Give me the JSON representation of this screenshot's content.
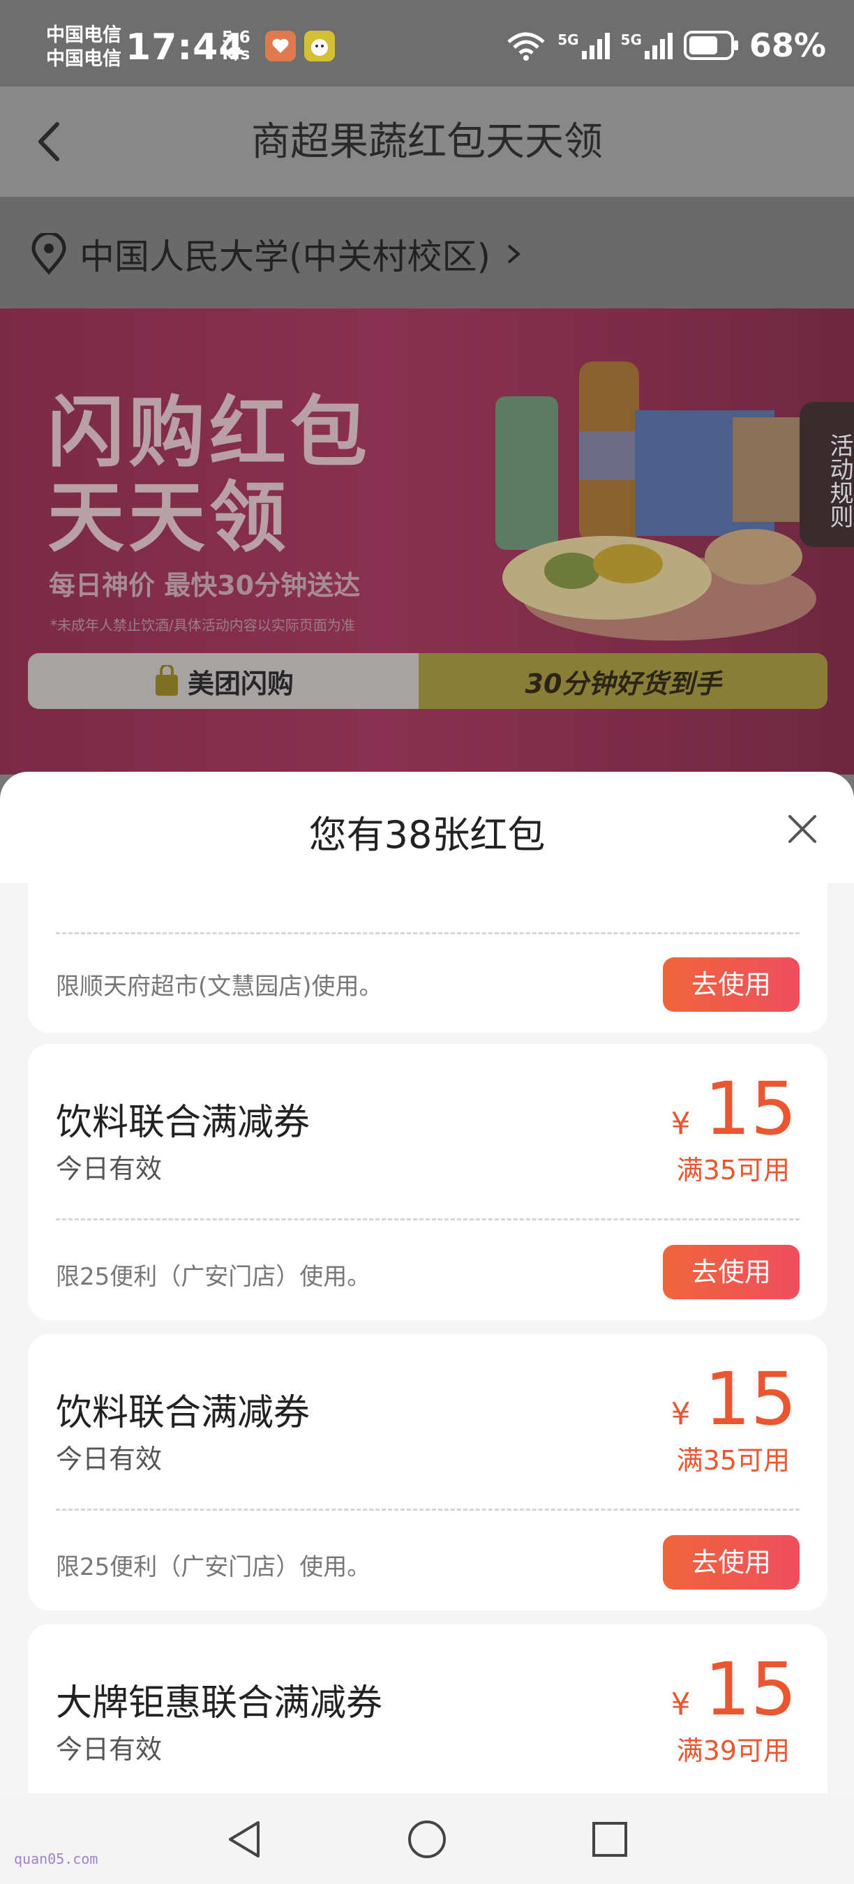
{
  "status_bar": {
    "carrier_1": "中国电信",
    "carrier_2": "中国电信",
    "time": "17:44",
    "speed_value": "5.6",
    "speed_unit": "K/s",
    "signal_1": "5G",
    "signal_2": "5G",
    "battery": "68%"
  },
  "header": {
    "title": "商超果蔬红包天天领"
  },
  "location": {
    "text": "中国人民大学(中关村校区)"
  },
  "banner": {
    "headline_1": "闪购红包",
    "headline_2": "天天领",
    "subtitle": "每日神价 最快30分钟送达",
    "note": "*未成年人禁止饮酒/具体活动内容以实际页面为准",
    "brand_label": "美团闪购",
    "slogan": "30分钟好货到手",
    "rules_label": "活动规则"
  },
  "sheet": {
    "title": "您有38张红包",
    "coupons": [
      {
        "limit": "限顺天府超市(文慧园店)使用。",
        "button": "去使用"
      },
      {
        "name": "饮料联合满减券",
        "validity": "今日有效",
        "currency": "¥",
        "amount": "15",
        "minimum": "满35可用",
        "limit": "限25便利（广安门店）使用。",
        "button": "去使用"
      },
      {
        "name": "饮料联合满减券",
        "validity": "今日有效",
        "currency": "¥",
        "amount": "15",
        "minimum": "满35可用",
        "limit": "限25便利（广安门店）使用。",
        "button": "去使用"
      },
      {
        "name": "大牌钜惠联合满减券",
        "validity": "今日有效",
        "currency": "¥",
        "amount": "15",
        "minimum": "满39可用"
      }
    ]
  },
  "watermark": "quan05.com",
  "colors": {
    "accent": "#e9562f",
    "button_start": "#f0653a",
    "button_end": "#ee4e5e"
  }
}
